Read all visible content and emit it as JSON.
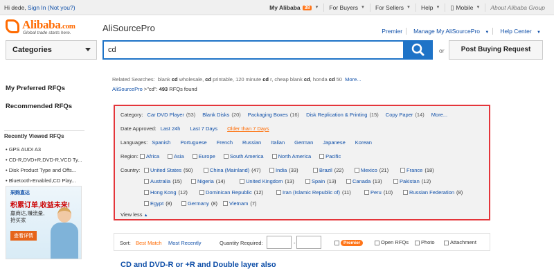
{
  "topbar": {
    "greeting": "Hi dede, ",
    "signin": "Sign In",
    "notyou": "(Not you?)",
    "my_alibaba": "My Alibaba",
    "badge": "38",
    "for_buyers": "For Buyers",
    "for_sellers": "For Sellers",
    "help": "Help",
    "mobile": "Mobile",
    "about": "About Alibaba Group"
  },
  "header": {
    "logo_word": "Alibaba",
    "logo_dc": ".com",
    "logo_tag": "Global trade starts here.",
    "product": "AliSourcePro",
    "links": [
      "Premier",
      "Manage My AliSourcePro",
      "Help Center"
    ]
  },
  "search": {
    "category_label": "Categories",
    "query": "cd",
    "or": "or",
    "post_button": "Post Buying Request"
  },
  "sidebar": {
    "my_rfqs": "My Preferred RFQs",
    "recommended": "Recommended RFQs",
    "recent_title": "Recently Viewed RFQs",
    "recent_items": [
      "GPS AUDI A3",
      "CD-R,DVD+R,DVD-R,VCD Ty...",
      "Disk Product Type and Offs...",
      "Bluetooth-Enabled,CD Play..."
    ],
    "ad": {
      "brand": "采购直达",
      "headline": "积累订单,收益未来!",
      "line1": "赢商达,赚流量,",
      "line2": "抢买家",
      "cta": "查看详情"
    }
  },
  "related": {
    "label": "Related Searches:",
    "items": [
      {
        "pre": "blank ",
        "b": "cd",
        "post": " wholesale"
      },
      {
        "pre": ", ",
        "b": "cd",
        "post": " printable"
      },
      {
        "pre": ", 120 minute ",
        "b": "cd",
        "post": " r"
      },
      {
        "pre": ", cheap blank ",
        "b": "cd",
        "post": ""
      },
      {
        "pre": ", honda ",
        "b": "cd",
        "post": " 50"
      }
    ],
    "more": "More..."
  },
  "crumb": {
    "root": "AliSourcePro",
    "sep": " >\"cd\": ",
    "count": "493",
    "tail": " RFQs found"
  },
  "filter": {
    "category_label": "Category:",
    "categories": [
      {
        "name": "Car DVD Player",
        "count": "(53)"
      },
      {
        "name": "Blank Disks",
        "count": "(20)"
      },
      {
        "name": "Packaging Boxes",
        "count": "(16)"
      },
      {
        "name": "Disk Replication & Printing",
        "count": "(15)"
      },
      {
        "name": "Copy Paper",
        "count": "(14)"
      }
    ],
    "category_more": "More...",
    "date_label": "Date Approved:",
    "dates": [
      "Last 24h",
      "Last 7 Days",
      "Older than 7 Days"
    ],
    "lang_label": "Languages:",
    "languages": [
      "Spanish",
      "Portuguese",
      "French",
      "Russian",
      "Italian",
      "German",
      "Japanese",
      "Korean"
    ],
    "region_label": "Region:",
    "regions": [
      "Africa",
      "Asia",
      "Europe",
      "South America",
      "North America",
      "Pacific"
    ],
    "country_label": "Country:",
    "countries": [
      [
        {
          "n": "United States",
          "c": "(50)"
        },
        {
          "n": "China (Mainland)",
          "c": "(47)"
        },
        {
          "n": "India",
          "c": "(33)"
        },
        {
          "n": "Brazil",
          "c": "(22)"
        },
        {
          "n": "Mexico",
          "c": "(21)"
        },
        {
          "n": "France",
          "c": "(18)"
        }
      ],
      [
        {
          "n": "Australia",
          "c": "(15)"
        },
        {
          "n": "Nigeria",
          "c": "(14)"
        },
        {
          "n": "United Kingdom",
          "c": "(13)"
        },
        {
          "n": "Spain",
          "c": "(13)"
        },
        {
          "n": "Canada",
          "c": "(13)"
        },
        {
          "n": "Pakistan",
          "c": "(12)"
        }
      ],
      [
        {
          "n": "Hong Kong",
          "c": "(12)"
        },
        {
          "n": "Dominican Republic",
          "c": "(12)"
        },
        {
          "n": "Iran (Islamic Republic of)",
          "c": "(11)"
        },
        {
          "n": "Peru",
          "c": "(10)"
        },
        {
          "n": "Russian Federation",
          "c": "(8)"
        }
      ],
      [
        {
          "n": "Egypt",
          "c": "(8)"
        },
        {
          "n": "Germany",
          "c": "(8)"
        },
        {
          "n": "Vietnam",
          "c": "(7)"
        }
      ]
    ],
    "view_less": "View less"
  },
  "sortbar": {
    "sort_label": "Sort:",
    "best": "Best Match",
    "recent": "Most Recently",
    "qty_label": "Quantity Required:",
    "dash": "-",
    "premier": "Premier",
    "open": "Open RFQs",
    "photo": "Photo",
    "attach": "Attachment"
  },
  "result_title": "CD and DVD-R or +R and Double layer also"
}
